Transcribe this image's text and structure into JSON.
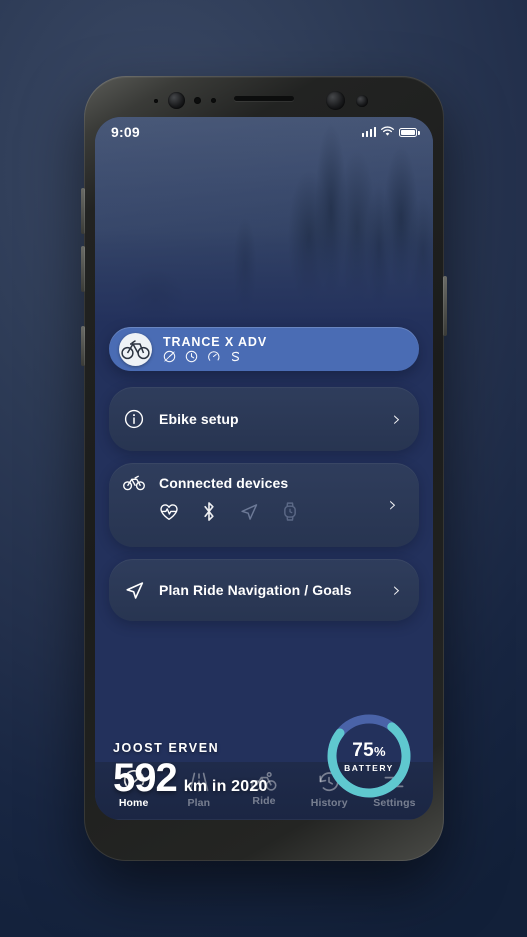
{
  "status_bar": {
    "time": "9:09",
    "signal_icon": "signal-bars-icon",
    "wifi_icon": "wifi-icon",
    "battery_icon": "battery-full-icon"
  },
  "hero": {
    "user_name": "JOOST ERVEN",
    "distance_value": "592",
    "distance_unit": "km in 2020",
    "battery": {
      "percent_value": "75",
      "percent_symbol": "%",
      "caption": "BATTERY",
      "level": 75,
      "arc_color": "#5fc8cf",
      "track_color": "#4a63a8"
    }
  },
  "bike_card": {
    "name": "TRANCE X ADV",
    "avatar_icon": "bicycle-photo-icon",
    "background_color": "#4a6cb4",
    "stat_icons": [
      "speedometer-icon",
      "clock-icon",
      "gauge-icon",
      "s-curve-icon"
    ]
  },
  "cards": [
    {
      "id": "ebike-setup",
      "label": "Ebike setup",
      "icon": "info-circle-icon",
      "chevron": "›"
    },
    {
      "id": "connected-devices",
      "label": "Connected devices",
      "icon": "bicycle-icon",
      "chevron": "›",
      "device_icons": [
        "heart-rate-icon",
        "bluetooth-icon",
        "navigation-arrow-icon",
        "smartwatch-icon"
      ]
    },
    {
      "id": "plan-ride",
      "label": "Plan Ride Navigation / Goals",
      "icon": "navigation-arrow-icon",
      "chevron": "›"
    }
  ],
  "bottom_nav": {
    "items": [
      {
        "label": "Home",
        "icon": "speedometer-icon",
        "active": true
      },
      {
        "label": "Plan",
        "icon": "road-icon",
        "active": false
      },
      {
        "label": "Ride",
        "icon": "bicycle-icon",
        "active": false
      },
      {
        "label": "History",
        "icon": "history-icon",
        "active": false
      },
      {
        "label": "Settings",
        "icon": "sliders-icon",
        "active": false
      }
    ]
  },
  "theme": {
    "accent_teal": "#5fc8cf",
    "accent_blue": "#4a6cb4",
    "screen_bg": "#23315c",
    "card_bg": "#2a3650"
  }
}
